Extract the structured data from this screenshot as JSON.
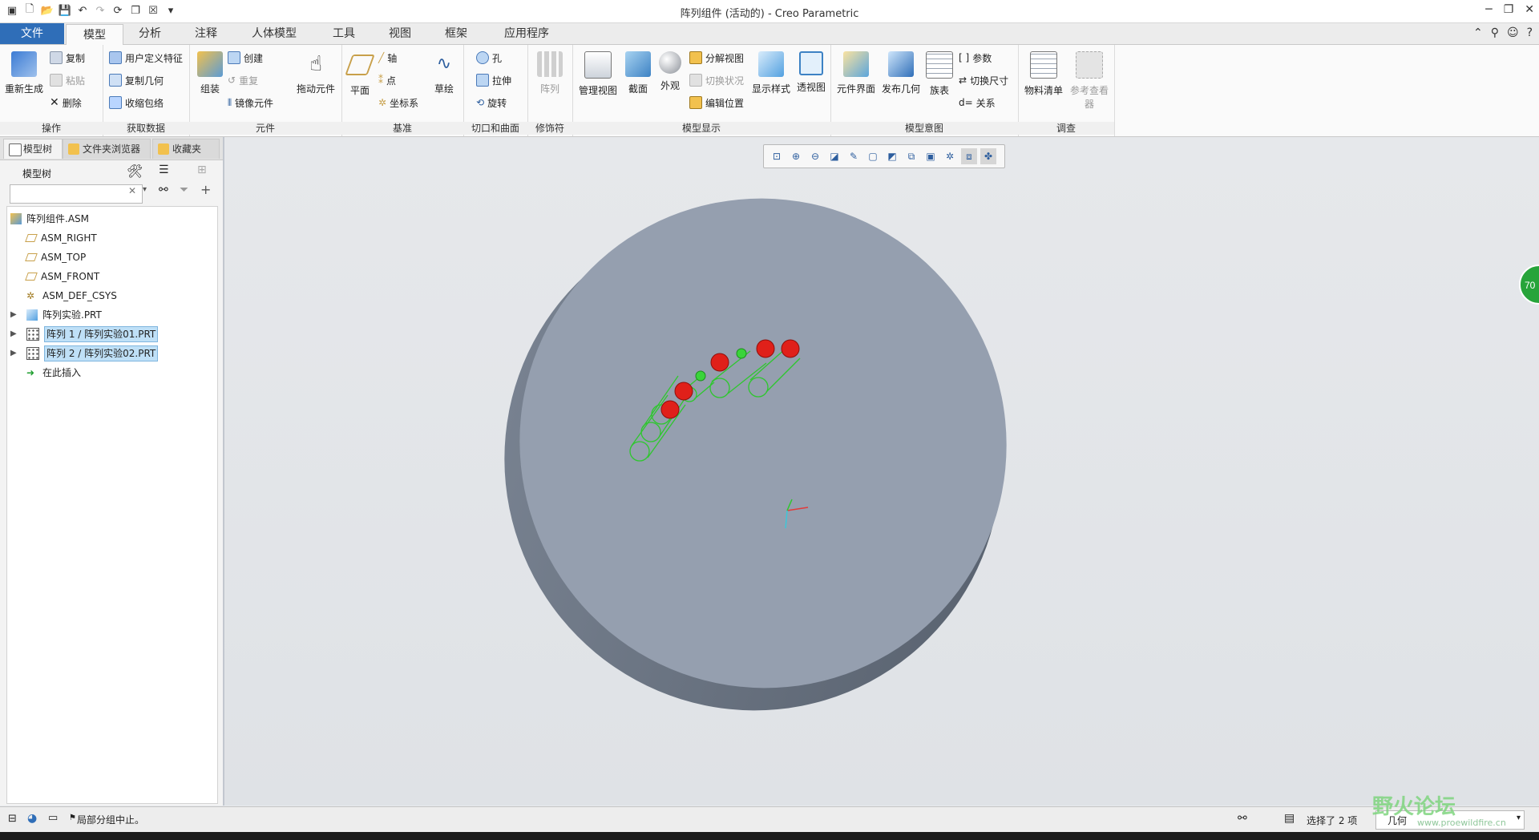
{
  "window": {
    "title": "阵列组件 (活动的) - Creo Parametric"
  },
  "menu_tabs": [
    "文件",
    "模型",
    "分析",
    "注释",
    "人体模型",
    "工具",
    "视图",
    "框架",
    "应用程序"
  ],
  "active_tab": "模型",
  "ribbon": {
    "groups": {
      "operations": {
        "label": "操作",
        "regen": "重新生成",
        "copy": "复制",
        "paste": "粘贴",
        "delete": "删除"
      },
      "get_data": {
        "label": "获取数据",
        "udf": "用户定义特征",
        "copy_geom": "复制几何",
        "shrinkwrap": "收缩包络"
      },
      "component": {
        "label": "元件",
        "assemble": "组装",
        "create": "创建",
        "repeat": "重复",
        "mirror": "镜像元件",
        "drag": "拖动元件"
      },
      "datum": {
        "label": "基准",
        "plane": "平面",
        "axis": "轴",
        "point": "点",
        "csys": "坐标系",
        "sketch": "草绘"
      },
      "cut_surface": {
        "label": "切口和曲面",
        "hole": "孔",
        "extrude": "拉伸",
        "revolve": "旋转"
      },
      "modifiers": {
        "label": "修饰符",
        "pattern": "阵列"
      },
      "model_display": {
        "label": "模型显示",
        "manage_view": "管理视图",
        "section": "截面",
        "appearance": "外观",
        "explode": "分解视图",
        "toggle_status": "切换状况",
        "edit_position": "编辑位置",
        "display_style": "显示样式",
        "perspective": "透视图"
      },
      "model_intent": {
        "label": "模型意图",
        "component_interface": "元件界面",
        "publish_geom": "发布几何",
        "family_table": "族表",
        "parameters": "参数",
        "switch_dims": "切换尺寸",
        "relations": "关系"
      },
      "investigate": {
        "label": "调查",
        "bom": "物料清单",
        "ref_viewer": "参考查看器"
      }
    }
  },
  "left_panel": {
    "tabs": [
      "模型树",
      "文件夹浏览器",
      "收藏夹"
    ],
    "tree_label": "模型树",
    "search_placeholder": "",
    "tree": [
      {
        "label": "阵列组件.ASM",
        "icon": "assembly-icon",
        "level": 0
      },
      {
        "label": "ASM_RIGHT",
        "icon": "datum-plane-icon",
        "level": 1
      },
      {
        "label": "ASM_TOP",
        "icon": "datum-plane-icon",
        "level": 1
      },
      {
        "label": "ASM_FRONT",
        "icon": "datum-plane-icon",
        "level": 1
      },
      {
        "label": "ASM_DEF_CSYS",
        "icon": "csys-icon",
        "level": 1
      },
      {
        "label": "阵列实验.PRT",
        "icon": "part-icon",
        "level": 1,
        "expandable": true
      },
      {
        "label": "阵列 1 / 阵列实验01.PRT",
        "icon": "pattern-icon",
        "level": 1,
        "expandable": true,
        "selected": true
      },
      {
        "label": "阵列 2 / 阵列实验02.PRT",
        "icon": "pattern-icon",
        "level": 1,
        "expandable": true,
        "selected": true
      },
      {
        "label": "在此插入",
        "icon": "insert-here-icon",
        "level": 1
      }
    ]
  },
  "status": {
    "message": "局部分组中止。",
    "filter": "几何",
    "selected": "选择了 2 项"
  },
  "watermark": {
    "title": "野火论坛",
    "url": "www.proewildfire.cn"
  },
  "side_badge": "70",
  "colors": {
    "file_tab": "#2f6eb8",
    "selection": "#bfe0f7",
    "model_disk": "#959faf",
    "pattern_green": "#2ec72e",
    "pattern_red": "#e0201a",
    "annotation_red": "#e5141a"
  }
}
